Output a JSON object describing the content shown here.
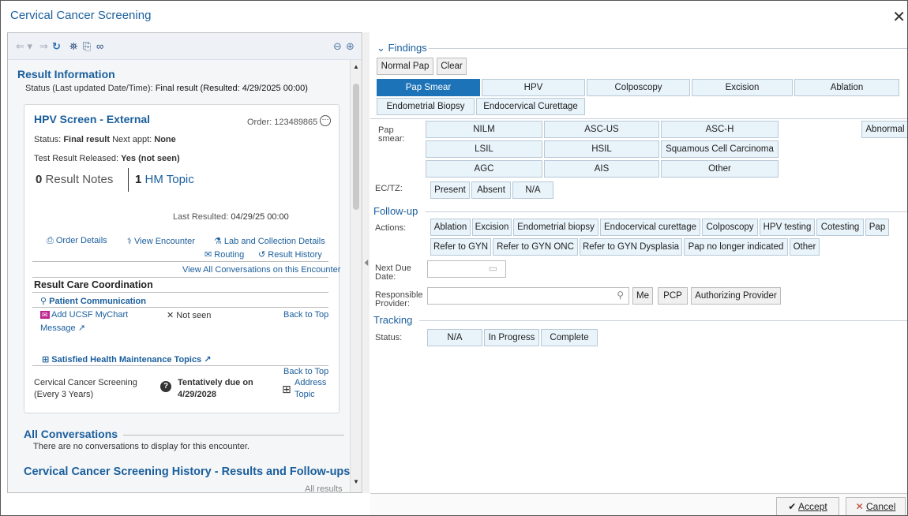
{
  "window": {
    "title": "Cervical Cancer Screening",
    "close": "✕"
  },
  "left": {
    "result_info": {
      "heading": "Result Information",
      "status_label": "Status (Last updated Date/Time):",
      "status_value": "Final result (Resulted: 4/29/2025 00:00)"
    },
    "card": {
      "title": "HPV Screen - External",
      "order_label": "Order: 123489865",
      "status_line_label": "Status:",
      "status_line_value": "Final result",
      "next_appt_label": "Next appt:",
      "next_appt_value": "None",
      "released_label": "Test Result Released:",
      "released_value": "Yes (not seen)",
      "result_notes_count": "0",
      "result_notes_label": "Result Notes",
      "hm_count": "1",
      "hm_label": "HM Topic",
      "last_resulted_label": "Last Resulted:",
      "last_resulted_value": "04/29/25 00:00",
      "order_details": "Order Details",
      "view_encounter": "View Encounter",
      "lab_details": "Lab and Collection Details",
      "routing": "Routing",
      "result_history": "Result History",
      "view_all": "View All Conversations on this Encounter",
      "care_coord": "Result Care Coordination",
      "patient_comm": "Patient Communication",
      "add_mychart": "Add UCSF MyChart",
      "message": "Message",
      "not_seen": "Not seen",
      "back_to_top": "Back to Top",
      "satisfied": "Satisfied Health Maintenance Topics",
      "back_to_top2": "Back to Top",
      "topic_name": "Cervical Cancer Screening",
      "topic_freq": "(Every 3 Years)",
      "tentative": "Tentatively due on",
      "tentative_date": "4/29/2028",
      "address": "Address",
      "topic": "Topic"
    },
    "all_conv": {
      "heading": "All Conversations",
      "text": "There are no conversations to display for this encounter."
    },
    "history": {
      "heading": "Cervical Cancer Screening History - Results and Follow-ups",
      "all_results": "All results"
    }
  },
  "findings": {
    "heading": "Findings",
    "normal_pap": "Normal Pap",
    "clear": "Clear",
    "tabs": [
      "Pap Smear",
      "HPV",
      "Colposcopy",
      "Excision",
      "Ablation",
      "Endometrial Biopsy",
      "Endocervical Curettage"
    ],
    "pap_label": "Pap smear:",
    "pap_options": [
      "NILM",
      "ASC-US",
      "ASC-H",
      "LSIL",
      "HSIL",
      "Squamous Cell Carcinoma",
      "AGC",
      "AIS",
      "Other"
    ],
    "abnormal": "Abnormal",
    "ectz_label": "EC/TZ:",
    "ectz_options": [
      "Present",
      "Absent",
      "N/A"
    ]
  },
  "followup": {
    "heading": "Follow-up",
    "actions_label": "Actions:",
    "actions": [
      "Ablation",
      "Excision",
      "Endometrial biopsy",
      "Endocervical curettage",
      "Colposcopy",
      "HPV testing",
      "Cotesting",
      "Pap",
      "Refer to GYN",
      "Refer to GYN ONC",
      "Refer to GYN Dysplasia",
      "Pap no longer indicated",
      "Other"
    ],
    "next_due_label": "Next Due Date:",
    "provider_label": "Responsible Provider:",
    "me": "Me",
    "pcp": "PCP",
    "auth": "Authorizing Provider"
  },
  "tracking": {
    "heading": "Tracking",
    "status_label": "Status:",
    "options": [
      "N/A",
      "In Progress",
      "Complete"
    ]
  },
  "footer": {
    "accept": "Accept",
    "cancel": "Cancel"
  }
}
